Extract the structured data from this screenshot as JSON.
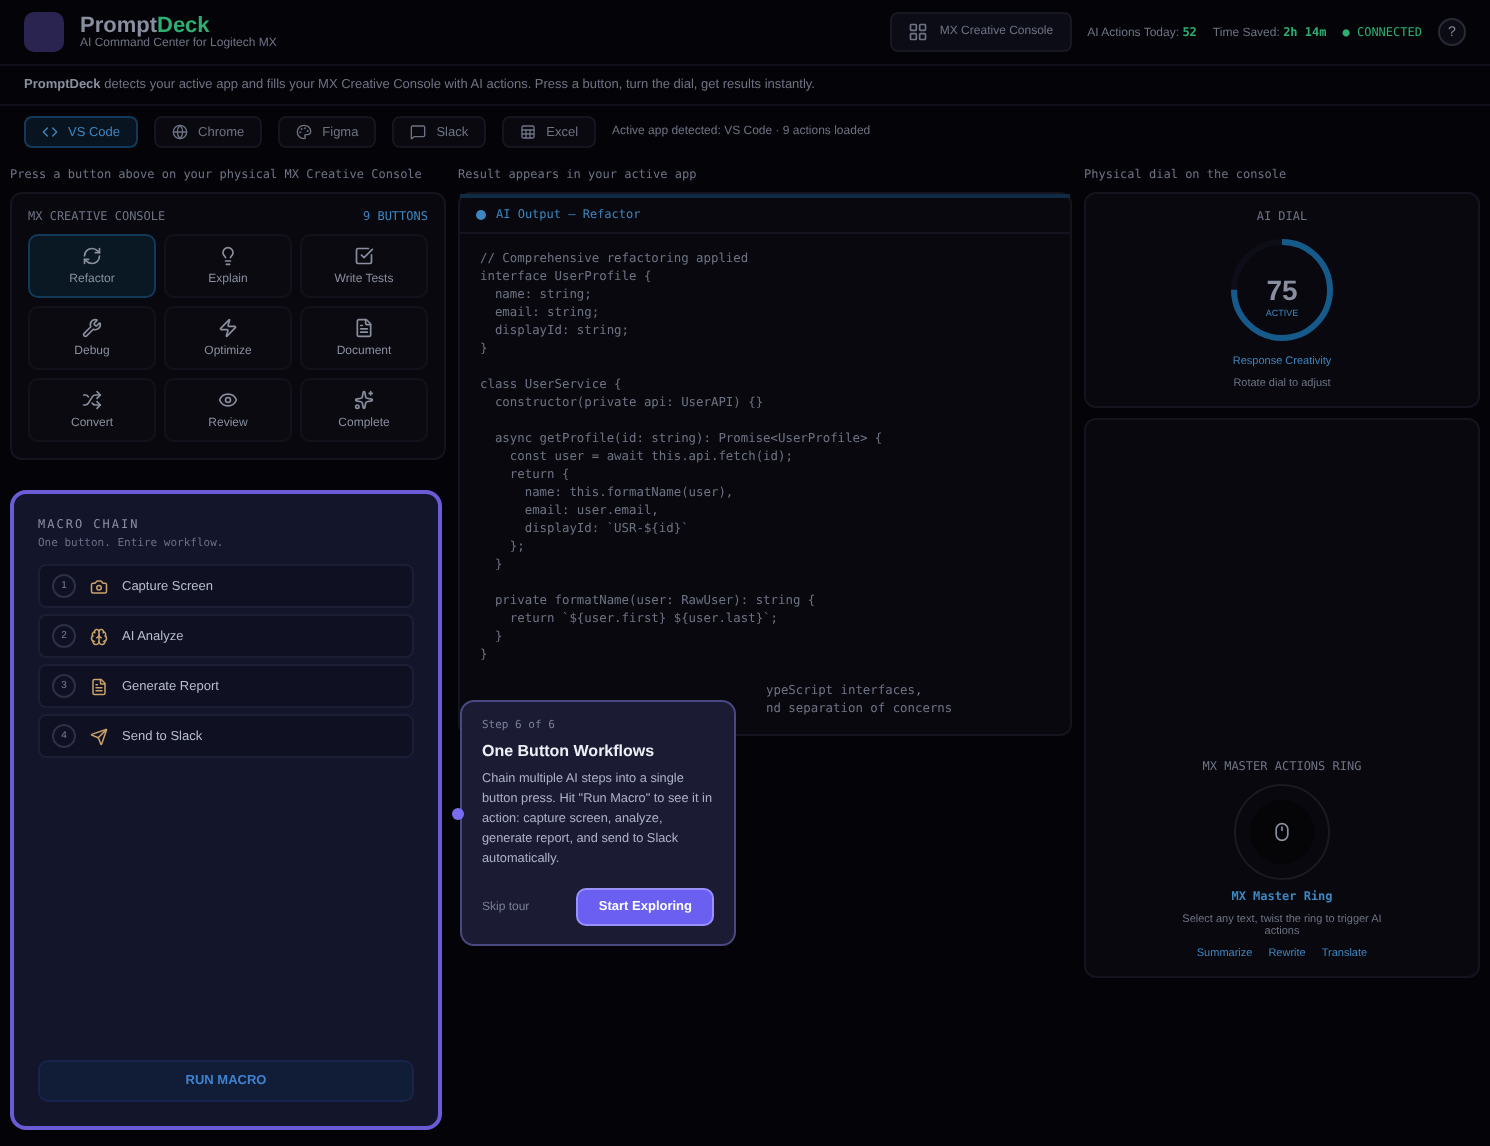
{
  "header": {
    "brand_main": "Prompt",
    "brand_accent": "Deck",
    "subtitle": "AI Command Center for Logitech MX",
    "device": "MX Creative Console",
    "stats": [
      {
        "label": "AI Actions Today:",
        "value": "52"
      },
      {
        "label": "Time Saved:",
        "value": "2h 14m"
      }
    ],
    "status": "● CONNECTED",
    "help": "?"
  },
  "intro": "**PromptDeck** detects your active app and fills your MX Creative Console with AI actions. Press a button, turn the dial, get results instantly.",
  "apps": [
    {
      "label": "VS Code",
      "selected": true
    },
    {
      "label": "Chrome",
      "selected": false
    },
    {
      "label": "Figma",
      "selected": false
    },
    {
      "label": "Slack",
      "selected": false
    },
    {
      "label": "Excel",
      "selected": false
    }
  ],
  "app_status": "Active app detected: VS Code · 9 actions loaded",
  "console": {
    "caption": "Press a button above on your physical MX Creative Console",
    "title": "MX CREATIVE CONSOLE",
    "count": "9 BUTTONS",
    "buttons": [
      {
        "label": "Refactor",
        "selected": true
      },
      {
        "label": "Explain",
        "selected": false
      },
      {
        "label": "Write Tests",
        "selected": false
      },
      {
        "label": "Debug",
        "selected": false
      },
      {
        "label": "Optimize",
        "selected": false
      },
      {
        "label": "Document",
        "selected": false
      },
      {
        "label": "Convert",
        "selected": false
      },
      {
        "label": "Review",
        "selected": false
      },
      {
        "label": "Complete",
        "selected": false
      }
    ]
  },
  "output": {
    "caption": "Result appears in your active app",
    "title": "AI Output — Refactor",
    "blocks": [
      [
        "// Comprehensive refactoring applied",
        "interface UserProfile {",
        "  name: string;",
        "  email: string;",
        "  displayId: string;",
        "}"
      ],
      [
        "class UserService {",
        "  constructor(private api: UserAPI) {}"
      ],
      [
        "  async getProfile(id: string): Promise<UserProfile> {",
        "    const user = await this.api.fetch(id);",
        "    return {",
        "      name: this.formatName(user),",
        "      email: user.email,",
        "      displayId: `USR-${id}`",
        "    };",
        "  }"
      ],
      [
        "  private formatName(user: RawUser): string {",
        "    return `${user.first} ${user.last}`;",
        "  }",
        "}"
      ]
    ],
    "covered_lines": [
      "ypeScript interfaces,",
      "nd separation of concerns"
    ]
  },
  "dial": {
    "caption": "Physical dial on the console",
    "title": "AI DIAL",
    "value": "75",
    "unit": "ACTIVE",
    "level": 0.75,
    "label": "Response Creativity",
    "hint": "Rotate dial to adjust"
  },
  "ring": {
    "caption": "MX MASTER ACTIONS RING",
    "title": "MX Master Ring",
    "hint": "Select any text, twist the ring to trigger AI actions",
    "links": [
      "Summarize",
      "Rewrite",
      "Translate"
    ]
  },
  "macro": {
    "title": "MACRO CHAIN",
    "subtitle": "One button. Entire workflow.",
    "steps": [
      {
        "number": "1",
        "label": "Capture Screen"
      },
      {
        "number": "2",
        "label": "AI Analyze"
      },
      {
        "number": "3",
        "label": "Generate Report"
      },
      {
        "number": "4",
        "label": "Send to Slack"
      }
    ],
    "run": "RUN MACRO"
  },
  "tour": {
    "step": "Step 6 of 6",
    "title": "One Button Workflows",
    "body": "Chain multiple AI steps into a single button press. Hit \"Run Macro\" to see it in action: capture screen, analyze, generate report, and send to Slack automatically.",
    "skip": "Skip tour",
    "next": "Start Exploring"
  }
}
